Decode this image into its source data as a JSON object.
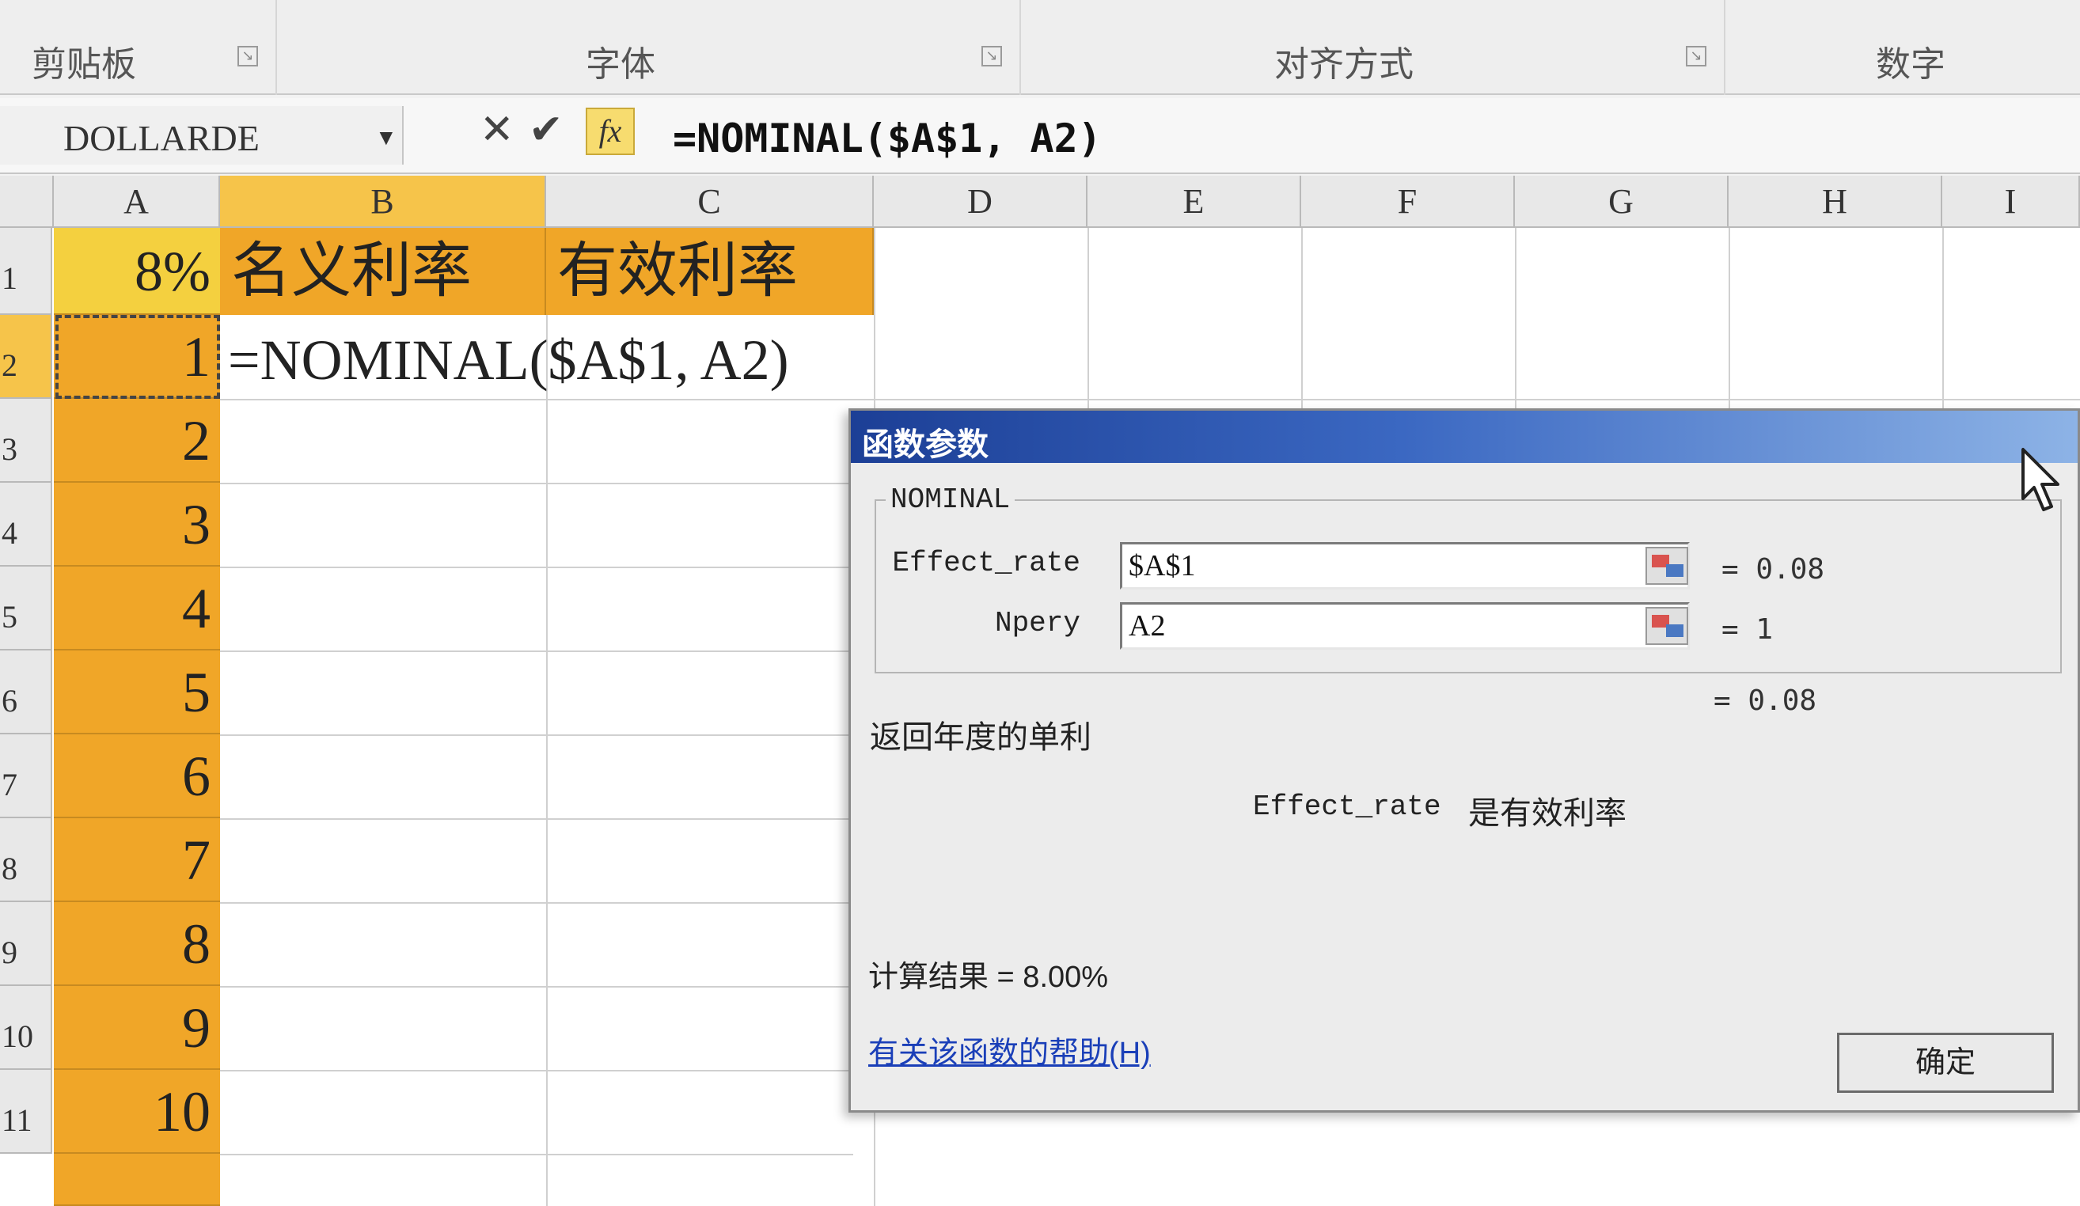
{
  "ribbon": {
    "groups": [
      {
        "label": "剪贴板"
      },
      {
        "label": "字体"
      },
      {
        "label": "对齐方式"
      },
      {
        "label": "数字"
      }
    ]
  },
  "formula_bar": {
    "name_box": "DOLLARDE",
    "cancel_symbol": "✕",
    "enter_symbol": "✔",
    "fx_label": "fx",
    "formula": "=NOMINAL($A$1, A2)"
  },
  "sheet": {
    "columns": [
      "A",
      "B",
      "C",
      "D",
      "E",
      "F",
      "G",
      "H",
      "I"
    ],
    "rows": [
      "1",
      "2",
      "3",
      "4",
      "5",
      "6",
      "7",
      "8",
      "9",
      "10",
      "11"
    ],
    "a1": "8%",
    "b1": "名义利率",
    "c1": "有效利率",
    "a_values": [
      "1",
      "2",
      "3",
      "4",
      "5",
      "6",
      "7",
      "8",
      "9",
      "10"
    ],
    "b2_edit": "=NOMINAL($A$1, A2)"
  },
  "dialog": {
    "title": "函数参数",
    "function_name": "NOMINAL",
    "args": [
      {
        "label": "Effect_rate",
        "value": "$A$1",
        "result": "= 0.08"
      },
      {
        "label": "Npery",
        "value": "A2",
        "result": "= 1"
      }
    ],
    "overall_result": "= 0.08",
    "description": "返回年度的单利",
    "arg_desc_name": "Effect_rate",
    "arg_desc_text": "是有效利率",
    "calc_result": "计算结果 = 8.00%",
    "help_link": "有关该函数的帮助(H)",
    "ok_button": "确定"
  }
}
